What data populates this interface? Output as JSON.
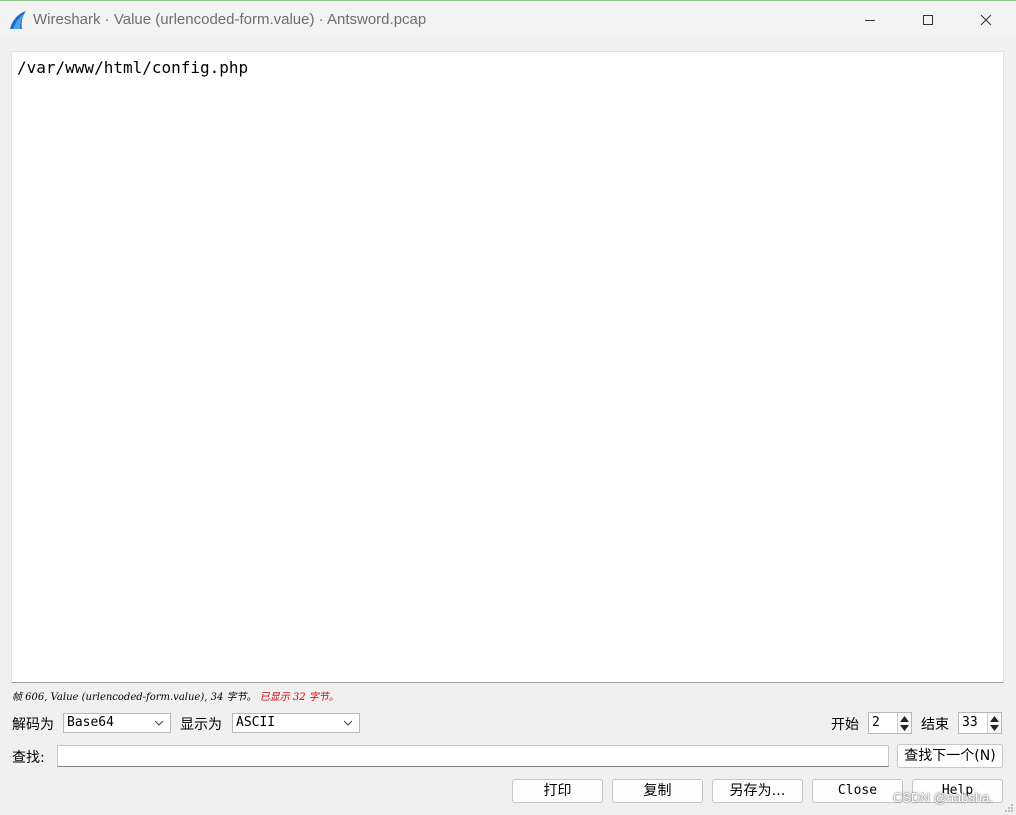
{
  "window": {
    "title": "Wireshark · Value (urlencoded-form.value) · Antsword.pcap"
  },
  "content": {
    "text": "/var/www/html/config.php"
  },
  "status": {
    "info": "帧 606, Value (urlencoded-form.value), 34 字节。",
    "shown": "已显示 32 字节。"
  },
  "decode": {
    "label": "解码为",
    "value": "Base64"
  },
  "show_as": {
    "label": "显示为",
    "value": "ASCII"
  },
  "start": {
    "label": "开始",
    "value": "2"
  },
  "end": {
    "label": "结束",
    "value": "33"
  },
  "find": {
    "label": "查找:",
    "next_button": "查找下一个(N)"
  },
  "buttons": {
    "print": "打印",
    "copy": "复制",
    "save_as": "另存为…",
    "close": "Close",
    "help": "Help"
  },
  "watermark": "CSDN @nabsha."
}
